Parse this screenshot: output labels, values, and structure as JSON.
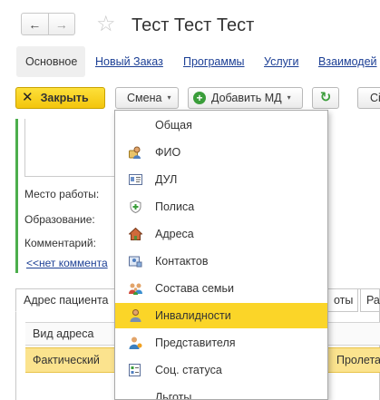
{
  "header": {
    "back_glyph": "←",
    "forward_glyph": "→",
    "star_glyph": "☆",
    "title": "Тест Тест Тест"
  },
  "section_tabs": [
    {
      "label": "Основное",
      "active": true
    },
    {
      "label": "Новый Заказ"
    },
    {
      "label": "Программы"
    },
    {
      "label": "Услуги"
    },
    {
      "label": "Взаимодей"
    }
  ],
  "toolbar": {
    "close_label": "Закрыть",
    "shift_label": "Смена",
    "add_label": "Добавить МД",
    "extra_label": "Сi",
    "close_glyph": "✕",
    "refresh_glyph": "↻",
    "caret_glyph": "▾"
  },
  "form": {
    "work_label": "Место работы:",
    "education_label": "Образование:",
    "comment_label": "Комментарий:",
    "more_link": "<<нет коммента"
  },
  "lower_tabs": [
    {
      "label": "Адрес пациента"
    },
    {
      "label": "оты"
    },
    {
      "label": "Ра"
    }
  ],
  "table": {
    "column_header": "Вид адреса",
    "selected_row": {
      "type": "Фактический",
      "street": "Пролета"
    }
  },
  "dropdown": {
    "items": [
      {
        "label": "Общая",
        "icon": "none"
      },
      {
        "label": "ФИО",
        "icon": "person-card-icon"
      },
      {
        "label": "ДУЛ",
        "icon": "id-card-icon"
      },
      {
        "label": "Полиса",
        "icon": "shield-plus-icon"
      },
      {
        "label": "Адреса",
        "icon": "house-icon"
      },
      {
        "label": "Контактов",
        "icon": "contact-card-icon"
      },
      {
        "label": "Состава семьи",
        "icon": "family-icon"
      },
      {
        "label": "Инвалидности",
        "icon": "person-disability-icon",
        "highlighted": true
      },
      {
        "label": "Представителя",
        "icon": "representative-icon"
      },
      {
        "label": "Соц. статуса",
        "icon": "social-status-icon"
      },
      {
        "label": "Льготы",
        "icon": "benefits-icon"
      }
    ]
  },
  "colors": {
    "accent_yellow": "#fbd528",
    "link_blue": "#1c3f95",
    "green": "#4cae4c"
  }
}
